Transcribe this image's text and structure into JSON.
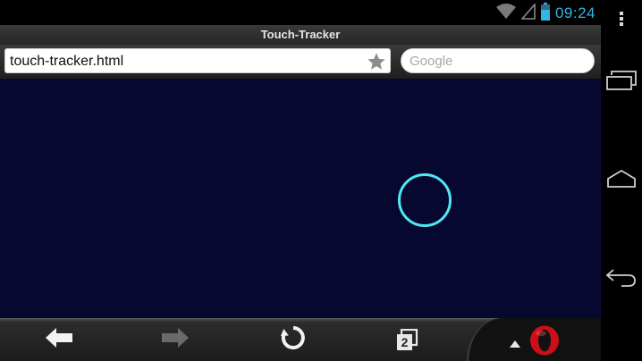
{
  "status_bar": {
    "time": "09:24",
    "icons": [
      "wifi-icon",
      "signal-icon",
      "battery-icon"
    ]
  },
  "browser": {
    "title": "Touch-Tracker",
    "url": "touch-tracker.html",
    "search_placeholder": "Google"
  },
  "bottom_bar": {
    "tabs_count": "2",
    "icons": [
      "back-arrow-icon",
      "forward-arrow-icon",
      "reload-icon",
      "tabs-icon",
      "opera-menu-icon"
    ]
  },
  "nav_bar": {
    "icons": [
      "overflow-menu-icon",
      "recent-apps-icon",
      "home-icon",
      "back-icon"
    ]
  },
  "colors": {
    "page_background": "#070830",
    "touch_circle": "#4fe8f2",
    "status_time": "#33b5e5",
    "opera_red": "#cc0f16"
  }
}
